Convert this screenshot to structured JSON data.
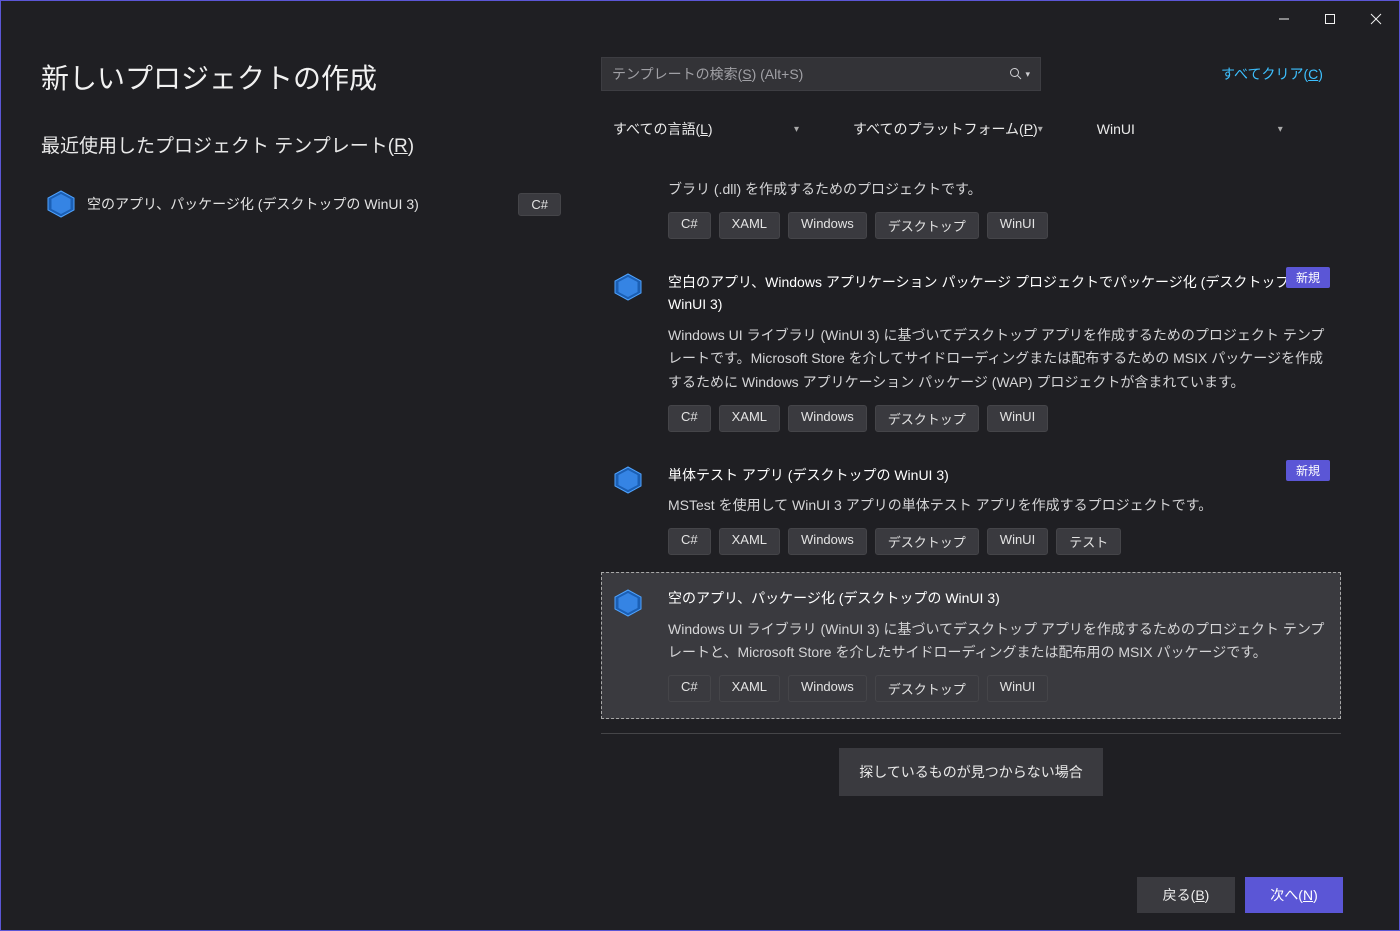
{
  "page_title": "新しいプロジェクトの作成",
  "recent_heading_pre": "最近使用したプロジェクト テンプレート(",
  "recent_heading_key": "R",
  "recent_heading_post": ")",
  "recent": {
    "name": "空のアプリ、パッケージ化 (デスクトップの WinUI 3)",
    "lang": "C#"
  },
  "search": {
    "placeholder_pre": "テンプレートの検索(",
    "placeholder_key": "S",
    "placeholder_post": ") (Alt+S)"
  },
  "clear_all_pre": "すべてクリア(",
  "clear_all_key": "C",
  "clear_all_post": ")",
  "filters": {
    "language_pre": "すべての言語(",
    "language_key": "L",
    "language_post": ")",
    "platform_pre": "すべてのプラットフォーム(",
    "platform_key": "P",
    "platform_post": ")",
    "project_type": "WinUI"
  },
  "templates": [
    {
      "title": "",
      "desc": "ブラリ (.dll) を作成するためのプロジェクトです。",
      "tags": [
        "C#",
        "XAML",
        "Windows",
        "デスクトップ",
        "WinUI"
      ],
      "new": false,
      "partial": true
    },
    {
      "title": "空白のアプリ、Windows アプリケーション パッケージ プロジェクトでパッケージ化 (デスクトップの WinUI 3)",
      "desc": "Windows UI ライブラリ (WinUI 3) に基づいてデスクトップ アプリを作成するためのプロジェクト テンプレートです。Microsoft Store を介してサイドローディングまたは配布するための MSIX パッケージを作成するために Windows アプリケーション パッケージ (WAP) プロジェクトが含まれています。",
      "tags": [
        "C#",
        "XAML",
        "Windows",
        "デスクトップ",
        "WinUI"
      ],
      "new": true
    },
    {
      "title": "単体テスト アプリ (デスクトップの WinUI 3)",
      "desc": "MSTest を使用して WinUI 3 アプリの単体テスト アプリを作成するプロジェクトです。",
      "tags": [
        "C#",
        "XAML",
        "Windows",
        "デスクトップ",
        "WinUI",
        "テスト"
      ],
      "new": true
    },
    {
      "title": "空のアプリ、パッケージ化 (デスクトップの WinUI 3)",
      "desc": "Windows UI ライブラリ (WinUI 3) に基づいてデスクトップ アプリを作成するためのプロジェクト テンプレートと、Microsoft Store を介したサイドローディングまたは配布用の MSIX パッケージです。",
      "tags": [
        "C#",
        "XAML",
        "Windows",
        "デスクトップ",
        "WinUI"
      ],
      "new": false,
      "selected": true
    }
  ],
  "not_found": "探しているものが見つからない場合",
  "new_badge": "新規",
  "buttons": {
    "back_pre": "戻る(",
    "back_key": "B",
    "back_post": ")",
    "next_pre": "次へ(",
    "next_key": "N",
    "next_post": ")"
  }
}
